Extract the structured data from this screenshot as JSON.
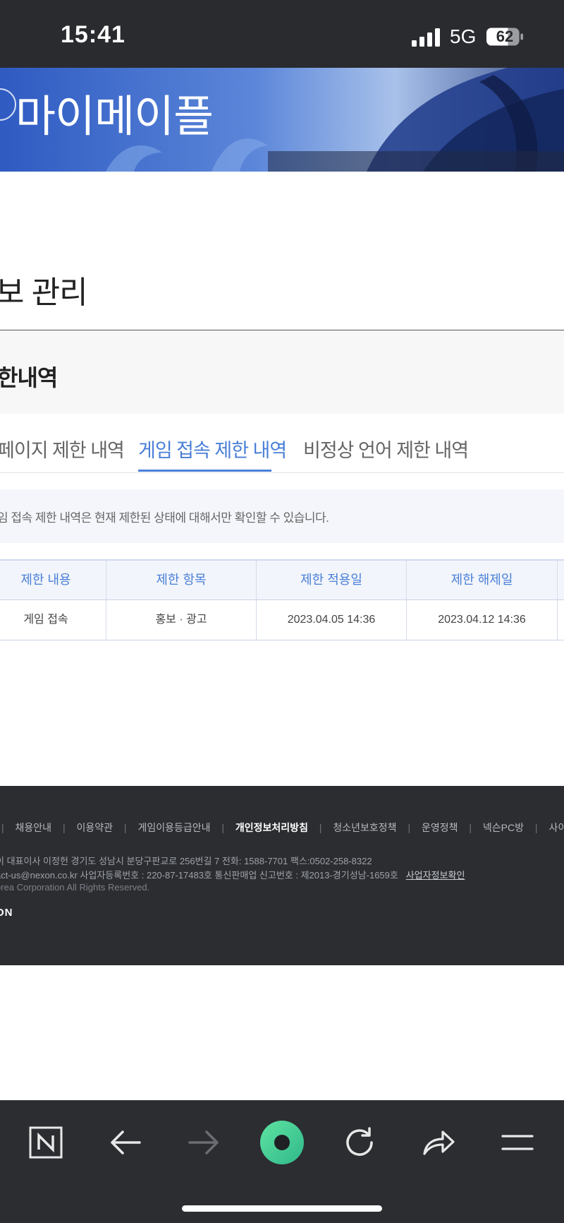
{
  "status_bar": {
    "time": "15:41",
    "network": "5G",
    "battery": "62"
  },
  "banner": {
    "title": "마이메이플"
  },
  "page": {
    "title": "보 관리"
  },
  "section": {
    "title": "한내역"
  },
  "tabs": [
    {
      "label": "페이지 제한 내역",
      "active": false
    },
    {
      "label": "게임 접속 제한 내역",
      "active": true
    },
    {
      "label": "비정상 언어 제한 내역",
      "active": false
    }
  ],
  "notice": "임 접속 제한 내역은 현재 제한된 상태에 대해서만 확인할 수 있습니다.",
  "table": {
    "headers": [
      "제한 내용",
      "제한 항목",
      "제한 적용일",
      "제한 해제일"
    ],
    "rows": [
      [
        "게임 접속",
        "홍보 · 광고",
        "2023.04.05 14:36",
        "2023.04.12 14:36"
      ]
    ]
  },
  "footer": {
    "links": [
      "채용안내",
      "이용약관",
      "게임이용등급안내",
      "개인정보처리방침",
      "청소년보호정책",
      "운영정책",
      "넥슨PC방",
      "사이트맵"
    ],
    "line1": "이 대표이사  이정헌 경기도 성남시 분당구판교로 256번길 7   전화: 1588-7701 팩스:0502-258-8322",
    "line2": "act-us@nexon.co.kr   사업자등록번호 : 220-87-17483호   통신판매업 신고번호 : 제2013-경기성남-1659호",
    "biz_link": "사업자정보확인",
    "line3": "orea Corporation All Rights Reserved.",
    "logo": "ON"
  },
  "toolbar": {
    "icons": [
      "naver-n-icon",
      "back-arrow-icon",
      "forward-arrow-icon",
      "green-dot-icon",
      "refresh-icon",
      "share-icon",
      "menu-icon"
    ]
  },
  "colors": {
    "accent": "#4a7fd7",
    "footer_bg": "#2b2d31",
    "status_bg": "#2a2b2f",
    "green": "#3ecf8e"
  }
}
